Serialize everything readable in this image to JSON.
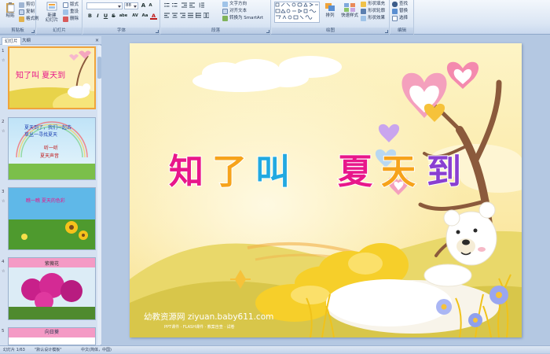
{
  "ribbon": {
    "clipboard": {
      "label": "剪贴板",
      "paste": "粘贴",
      "cut": "剪切",
      "copy": "复制",
      "format_painter": "格式刷"
    },
    "slides": {
      "label": "幻灯片",
      "new_slide": "新建\n幻灯片",
      "layout": "版式",
      "reset": "重设",
      "delete": "删除"
    },
    "font": {
      "label": "字体",
      "font_size": "88",
      "bold": "B",
      "italic": "I",
      "underline": "U",
      "strike": "S",
      "shadow": "abe",
      "spacing": "AV",
      "case": "Aa",
      "color": "A"
    },
    "paragraph": {
      "label": "段落",
      "text_direction": "文字方向",
      "align_text": "对齐文本",
      "smartart": "转换为 SmartArt"
    },
    "drawing": {
      "label": "绘图",
      "arrange": "排列",
      "quick_styles": "快速样式",
      "shape_fill": "形状填充",
      "shape_outline": "形状轮廓",
      "shape_effects": "形状效果"
    },
    "editing": {
      "label": "编辑",
      "find": "查找",
      "replace": "替换",
      "select": "选择"
    }
  },
  "panel": {
    "tabs": [
      "幻灯片",
      "大纲"
    ],
    "close": "×",
    "thumbnails": [
      {
        "number": "1",
        "title": "知了叫  夏天到"
      },
      {
        "number": "2",
        "line1": "夏天到了，我们一起去",
        "line2": "草丛一寻找夏天",
        "line3": "听一听",
        "line4": "夏天声音"
      },
      {
        "number": "3",
        "line1": "瞧一瞧 夏天的色彩"
      },
      {
        "number": "4",
        "title": "紫薇花"
      },
      {
        "number": "5",
        "title": "向日葵"
      }
    ]
  },
  "slide": {
    "title_chars": [
      "知",
      "了",
      "叫",
      "夏",
      "天",
      "到"
    ],
    "title_colors": [
      "#e8178a",
      "#f6a31b",
      "#22a9e0",
      "#e8178a",
      "#f6a31b",
      "#8a3fd1"
    ],
    "watermark": "幼教资源网 ziyuan.baby611.com",
    "watermark_sub": "PPT课件 · FLASH课件 · 教案自查 · 试卷"
  },
  "status": {
    "slide_info": "幻灯片 1/63",
    "theme": "\"默认设计模板\"",
    "language": "中文(简体，中国)"
  }
}
